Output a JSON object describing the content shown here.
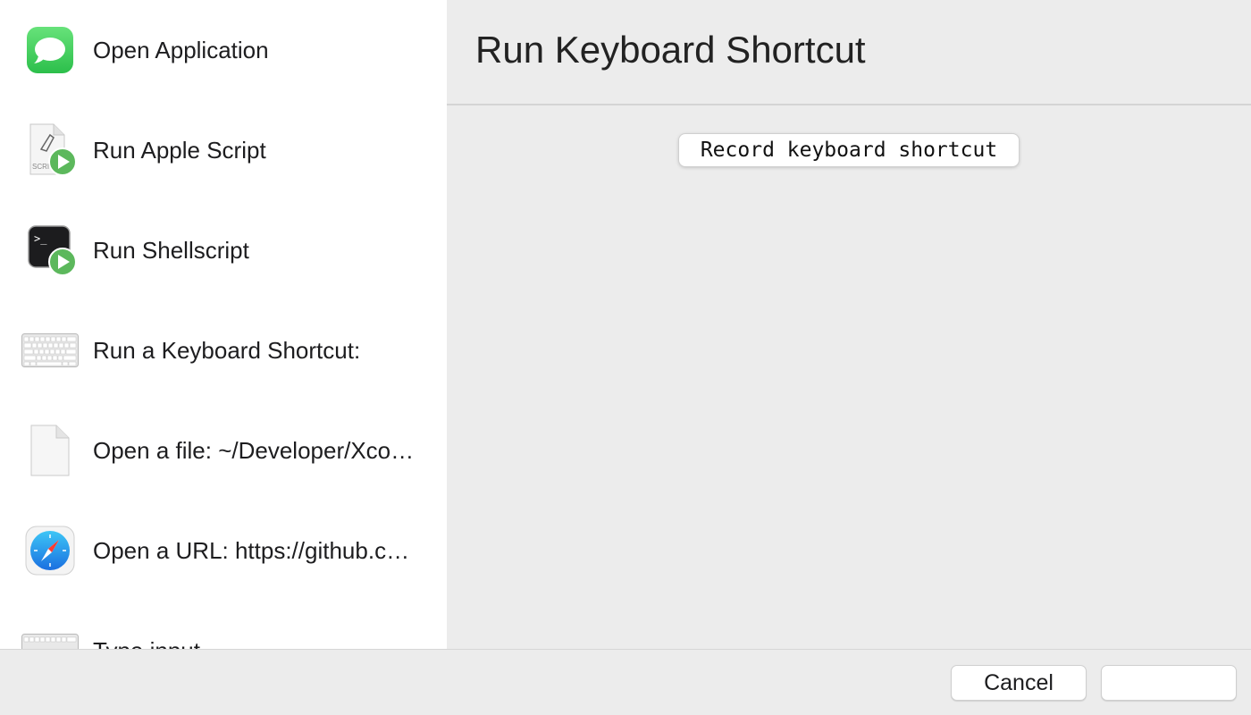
{
  "actions": [
    {
      "label": "Open Application",
      "icon": "messages-icon"
    },
    {
      "label": "Run Apple Script",
      "icon": "applescript-icon"
    },
    {
      "label": "Run Shellscript",
      "icon": "terminal-icon"
    },
    {
      "label": "Run a Keyboard Shortcut:",
      "icon": "keyboard-icon"
    },
    {
      "label": "Open a file: ~/Developer/Xco…",
      "icon": "file-icon"
    },
    {
      "label": "Open a URL: https://github.c…",
      "icon": "safari-icon"
    },
    {
      "label": "Type input",
      "icon": "keyboard-icon"
    }
  ],
  "main": {
    "title": "Run Keyboard Shortcut",
    "record_button_label": "Record keyboard shortcut"
  },
  "footer": {
    "cancel_label": "Cancel",
    "confirm_label": ""
  },
  "icons": {
    "script_badge_text": "SCRI",
    "terminal_prompt": ">_"
  },
  "colors": {
    "sidebar_bg": "#ffffff",
    "main_bg": "#ececec",
    "messages_green": "#35c759",
    "play_badge_green": "#5cb85c"
  }
}
